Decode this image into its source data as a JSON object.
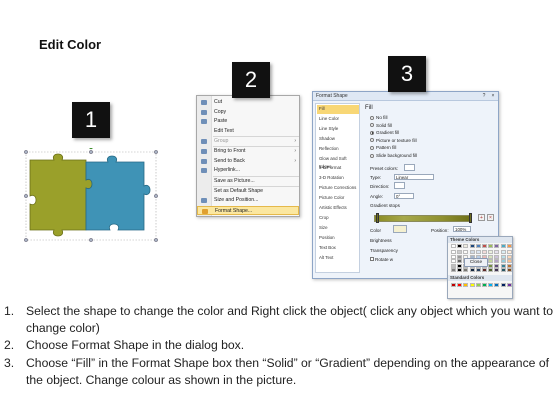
{
  "title": "Edit Color",
  "badges": [
    "1",
    "2",
    "3"
  ],
  "colors": {
    "puzzle_left": "#9aa02a",
    "puzzle_right": "#3f93b6",
    "badge_bg": "#111111",
    "highlight": "#fbe7a0"
  },
  "context_menu": {
    "items": [
      {
        "label": "Cut",
        "icon": "scissors-icon",
        "disabled": false,
        "submenu": false
      },
      {
        "label": "Copy",
        "icon": "copy-icon",
        "disabled": false,
        "submenu": false
      },
      {
        "label": "Paste",
        "icon": "paste-icon",
        "disabled": false,
        "submenu": false
      },
      {
        "label": "Edit Text",
        "icon": "",
        "disabled": false,
        "submenu": false
      },
      {
        "label": "Group",
        "icon": "group-icon",
        "disabled": true,
        "submenu": true
      },
      {
        "label": "Bring to Front",
        "icon": "bring-to-front-icon",
        "disabled": false,
        "submenu": true
      },
      {
        "label": "Send to Back",
        "icon": "send-to-back-icon",
        "disabled": false,
        "submenu": true
      },
      {
        "label": "Hyperlink...",
        "icon": "hyperlink-icon",
        "disabled": false,
        "submenu": false
      },
      {
        "label": "Save as Picture...",
        "icon": "",
        "disabled": false,
        "submenu": false
      },
      {
        "label": "Set as Default Shape",
        "icon": "",
        "disabled": false,
        "submenu": false
      },
      {
        "label": "Size and Position...",
        "icon": "size-icon",
        "disabled": false,
        "submenu": false
      },
      {
        "label": "Format Shape...",
        "icon": "format-shape-icon",
        "disabled": false,
        "submenu": false,
        "highlighted": true
      }
    ]
  },
  "dialog": {
    "title": "Format Shape",
    "title_buttons": [
      "?",
      "×"
    ],
    "nav": [
      "Fill",
      "Line Color",
      "Line Style",
      "Shadow",
      "Reflection",
      "Glow and Soft Edges",
      "3-D Format",
      "3-D Rotation",
      "Picture Corrections",
      "Picture Color",
      "Artistic Effects",
      "Crop",
      "Size",
      "Position",
      "Text Box",
      "Alt Text"
    ],
    "pane_title": "Fill",
    "fill_options": [
      "No fill",
      "Solid fill",
      "Gradient fill",
      "Picture or texture fill",
      "Pattern fill",
      "Slide background fill"
    ],
    "preset_colors_label": "Preset colors:",
    "type_label": "Type:",
    "type_value": "Linear",
    "direction_label": "Direction:",
    "angle_label": "Angle:",
    "angle_value": "0°",
    "gradient_stops_label": "Gradient stops",
    "color_label": "Color",
    "position_label": "Position:",
    "position_value": "100%",
    "brightness_label": "Brightness",
    "transparency_label": "Transparency",
    "rotate_label": "Rotate w",
    "theme_colors_label": "Theme Colors",
    "standard_colors_label": "Standard Colors",
    "close_label": "Close"
  },
  "theme_colors": [
    "#ffffff",
    "#000000",
    "#eeece1",
    "#1f497d",
    "#4f81bd",
    "#c0504d",
    "#9bbb59",
    "#8064a2",
    "#4bacc6",
    "#f79646"
  ],
  "standard_colors": [
    "#c00000",
    "#ff0000",
    "#ffc000",
    "#ffff00",
    "#92d050",
    "#00b050",
    "#00b0f0",
    "#0070c0",
    "#002060",
    "#7030a0"
  ],
  "steps": [
    {
      "num": "1.",
      "text": "Select the shape to change the color and Right click the object( click any object which you want to change color)"
    },
    {
      "num": "2.",
      "text": "Choose Format Shape in the dialog box."
    },
    {
      "num": "3.",
      "text": "Choose “Fill” in the Format Shape box then “Solid” or “Gradient” depending on the appearance of the object. Change colour as shown in the picture."
    }
  ]
}
